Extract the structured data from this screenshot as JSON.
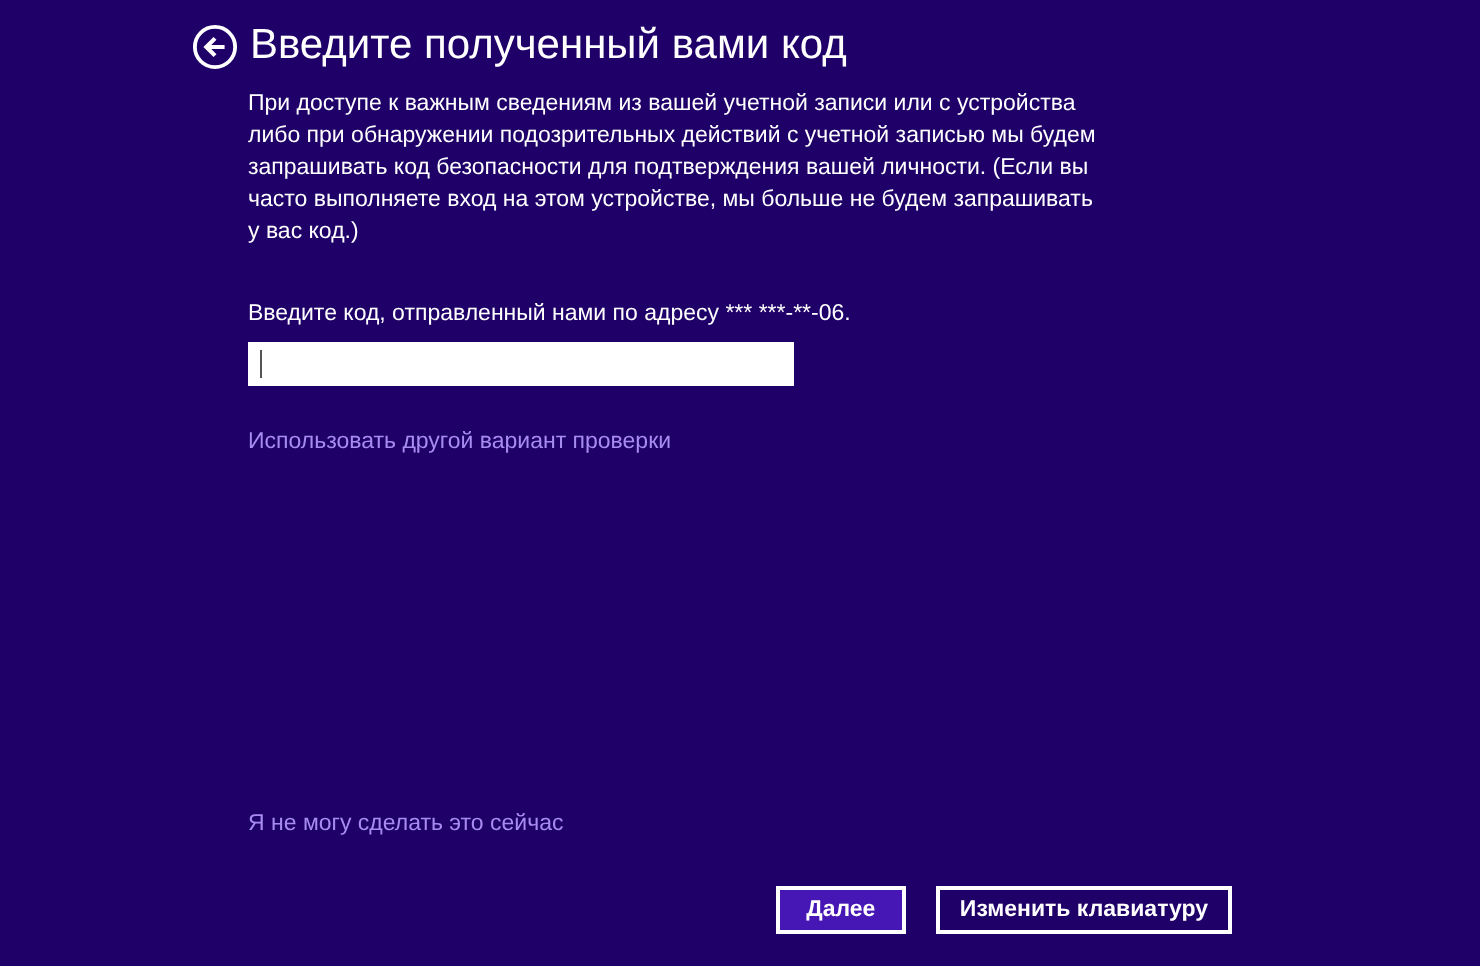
{
  "title": "Введите полученный вами код",
  "description": "При доступе к важным сведениям из вашей учетной записи или с устройства либо при обнаружении подозрительных действий с учетной записью мы будем запрашивать код безопасности для подтверждения вашей личности. (Если вы часто выполняете вход на этом устройстве, мы больше не будем запрашивать у вас код.)",
  "code_label": "Введите код, отправленный нами по адресу *** ***-**-06.",
  "code_field": {
    "focused": true
  },
  "alternate_link": "Использовать другой вариант проверки",
  "skip_link": "Я не могу сделать это сейчас",
  "buttons": [
    {
      "label": "Далее",
      "primary": true
    },
    {
      "label": "Изменить клавиатуру",
      "primary": false
    }
  ]
}
